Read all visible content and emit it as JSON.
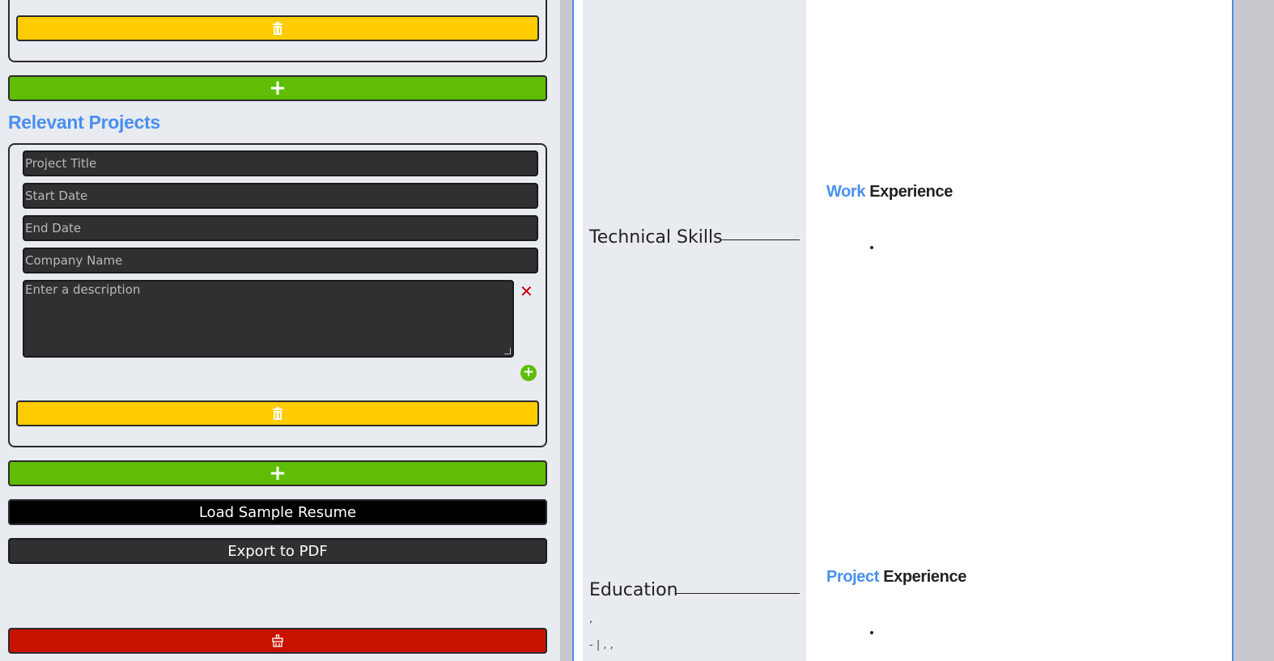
{
  "editor": {
    "add_label": "+",
    "projects": {
      "section_title": "Relevant Projects",
      "fields": {
        "title_placeholder": "Project Title",
        "start_placeholder": "Start Date",
        "end_placeholder": "End Date",
        "company_placeholder": "Company Name",
        "description_placeholder": "Enter a description"
      }
    },
    "actions": {
      "load_sample_label": "Load Sample Resume",
      "export_label": "Export to PDF"
    }
  },
  "preview": {
    "sidebar": {
      "technical_skills": "Technical Skills",
      "education": "Education",
      "education_line1": ",",
      "education_line2": "- | , ,"
    },
    "main": {
      "work_accent": "Work",
      "work_rest": "Experience",
      "project_accent": "Project",
      "project_rest": "Experience"
    }
  },
  "icons": {
    "delete": "trash-icon",
    "add": "plus-icon",
    "remove": "close-icon",
    "add_bullet": "plus-circle-icon",
    "reset": "reset-icon"
  },
  "colors": {
    "accent": "#4a8ff0",
    "add_green": "#5ebd04",
    "delete_yellow": "#ffcc00",
    "reset_red": "#c81200",
    "field_dark": "#303032"
  }
}
